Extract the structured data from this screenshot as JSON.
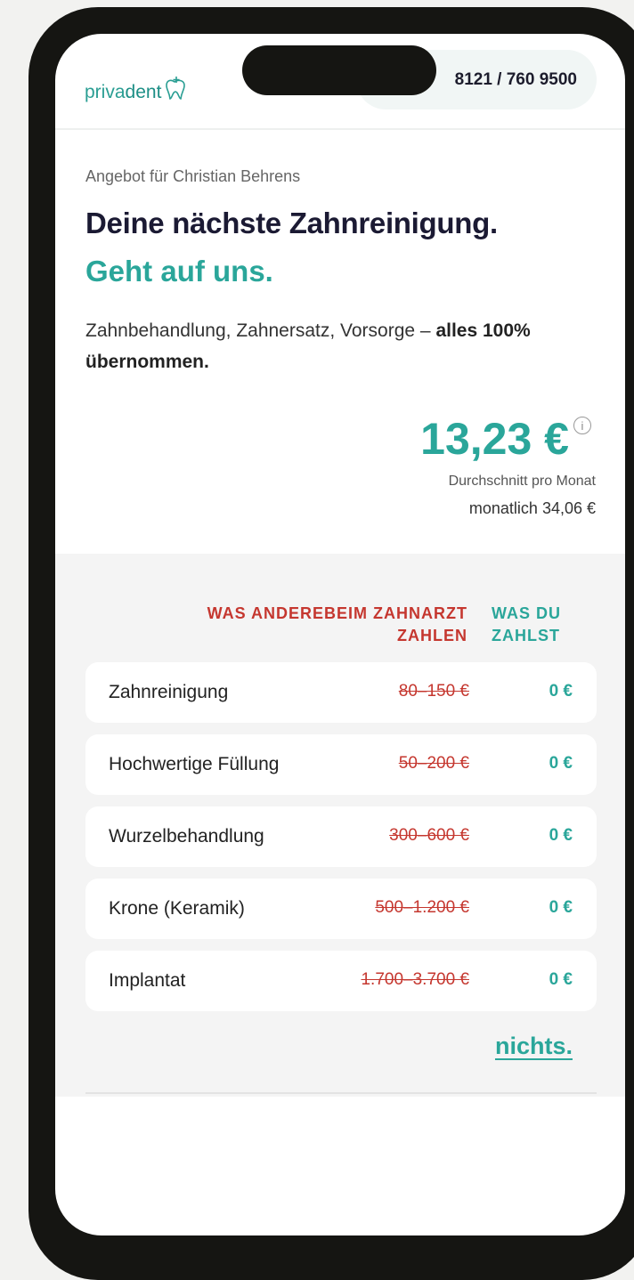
{
  "header": {
    "logo_prefix": "priva",
    "logo_suffix": "dent",
    "phone": "8121 / 760 9500"
  },
  "hero": {
    "offer_for": "Angebot für Christian Behrens",
    "headline": "Deine nächste Zahnreinigung.",
    "subheadline": "Geht auf uns.",
    "description_prefix": "Zahnbehandlung, Zahnersatz, Vorsorge – ",
    "description_bold": "alles 100% übernommen."
  },
  "pricing": {
    "price": "13,23 €",
    "info_icon": "i",
    "average_label": "Durchschnitt pro Monat",
    "monthly": "monatlich 34,06 €"
  },
  "comparison": {
    "header_others": "WAS ANDEREBEIM ZAHNARZT ZAHLEN",
    "header_you": "WAS DU ZAHLST",
    "rows": [
      {
        "name": "Zahnreinigung",
        "others": "80–150 €",
        "you": "0 €"
      },
      {
        "name": "Hochwertige Füllung",
        "others": "50–200 €",
        "you": "0 €"
      },
      {
        "name": "Wurzelbehandlung",
        "others": "300–600 €",
        "you": "0 €"
      },
      {
        "name": "Krone (Keramik)",
        "others": "500–1.200 €",
        "you": "0 €"
      },
      {
        "name": "Implantat",
        "others": "1.700–3.700 €",
        "you": "0 €"
      }
    ],
    "closing": "nichts."
  },
  "colors": {
    "accent": "#2aa69a",
    "negative": "#c5372f",
    "heading": "#1b1a33"
  }
}
